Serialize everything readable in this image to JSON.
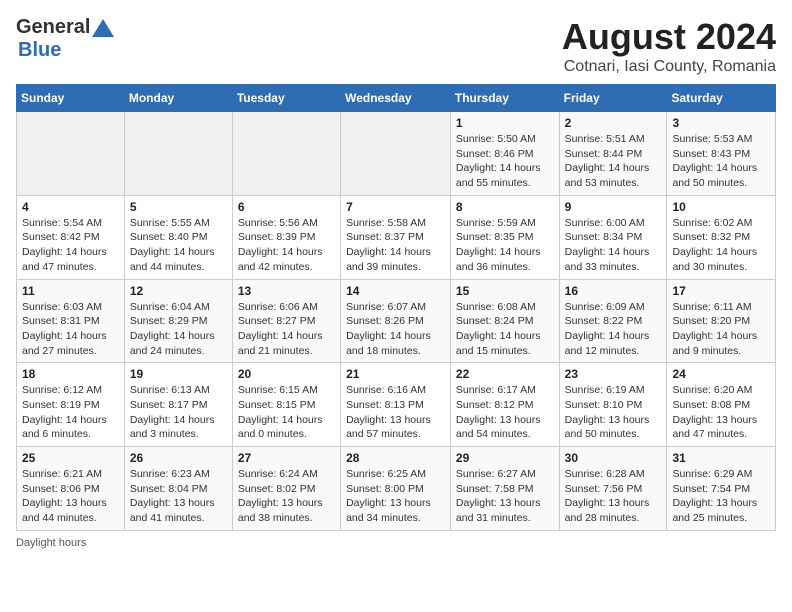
{
  "header": {
    "logo_line1": "General",
    "logo_line2": "Blue",
    "title": "August 2024",
    "subtitle": "Cotnari, Iasi County, Romania"
  },
  "days_of_week": [
    "Sunday",
    "Monday",
    "Tuesday",
    "Wednesday",
    "Thursday",
    "Friday",
    "Saturday"
  ],
  "weeks": [
    [
      {
        "day": "",
        "info": ""
      },
      {
        "day": "",
        "info": ""
      },
      {
        "day": "",
        "info": ""
      },
      {
        "day": "",
        "info": ""
      },
      {
        "day": "1",
        "info": "Sunrise: 5:50 AM\nSunset: 8:46 PM\nDaylight: 14 hours and 55 minutes."
      },
      {
        "day": "2",
        "info": "Sunrise: 5:51 AM\nSunset: 8:44 PM\nDaylight: 14 hours and 53 minutes."
      },
      {
        "day": "3",
        "info": "Sunrise: 5:53 AM\nSunset: 8:43 PM\nDaylight: 14 hours and 50 minutes."
      }
    ],
    [
      {
        "day": "4",
        "info": "Sunrise: 5:54 AM\nSunset: 8:42 PM\nDaylight: 14 hours and 47 minutes."
      },
      {
        "day": "5",
        "info": "Sunrise: 5:55 AM\nSunset: 8:40 PM\nDaylight: 14 hours and 44 minutes."
      },
      {
        "day": "6",
        "info": "Sunrise: 5:56 AM\nSunset: 8:39 PM\nDaylight: 14 hours and 42 minutes."
      },
      {
        "day": "7",
        "info": "Sunrise: 5:58 AM\nSunset: 8:37 PM\nDaylight: 14 hours and 39 minutes."
      },
      {
        "day": "8",
        "info": "Sunrise: 5:59 AM\nSunset: 8:35 PM\nDaylight: 14 hours and 36 minutes."
      },
      {
        "day": "9",
        "info": "Sunrise: 6:00 AM\nSunset: 8:34 PM\nDaylight: 14 hours and 33 minutes."
      },
      {
        "day": "10",
        "info": "Sunrise: 6:02 AM\nSunset: 8:32 PM\nDaylight: 14 hours and 30 minutes."
      }
    ],
    [
      {
        "day": "11",
        "info": "Sunrise: 6:03 AM\nSunset: 8:31 PM\nDaylight: 14 hours and 27 minutes."
      },
      {
        "day": "12",
        "info": "Sunrise: 6:04 AM\nSunset: 8:29 PM\nDaylight: 14 hours and 24 minutes."
      },
      {
        "day": "13",
        "info": "Sunrise: 6:06 AM\nSunset: 8:27 PM\nDaylight: 14 hours and 21 minutes."
      },
      {
        "day": "14",
        "info": "Sunrise: 6:07 AM\nSunset: 8:26 PM\nDaylight: 14 hours and 18 minutes."
      },
      {
        "day": "15",
        "info": "Sunrise: 6:08 AM\nSunset: 8:24 PM\nDaylight: 14 hours and 15 minutes."
      },
      {
        "day": "16",
        "info": "Sunrise: 6:09 AM\nSunset: 8:22 PM\nDaylight: 14 hours and 12 minutes."
      },
      {
        "day": "17",
        "info": "Sunrise: 6:11 AM\nSunset: 8:20 PM\nDaylight: 14 hours and 9 minutes."
      }
    ],
    [
      {
        "day": "18",
        "info": "Sunrise: 6:12 AM\nSunset: 8:19 PM\nDaylight: 14 hours and 6 minutes."
      },
      {
        "day": "19",
        "info": "Sunrise: 6:13 AM\nSunset: 8:17 PM\nDaylight: 14 hours and 3 minutes."
      },
      {
        "day": "20",
        "info": "Sunrise: 6:15 AM\nSunset: 8:15 PM\nDaylight: 14 hours and 0 minutes."
      },
      {
        "day": "21",
        "info": "Sunrise: 6:16 AM\nSunset: 8:13 PM\nDaylight: 13 hours and 57 minutes."
      },
      {
        "day": "22",
        "info": "Sunrise: 6:17 AM\nSunset: 8:12 PM\nDaylight: 13 hours and 54 minutes."
      },
      {
        "day": "23",
        "info": "Sunrise: 6:19 AM\nSunset: 8:10 PM\nDaylight: 13 hours and 50 minutes."
      },
      {
        "day": "24",
        "info": "Sunrise: 6:20 AM\nSunset: 8:08 PM\nDaylight: 13 hours and 47 minutes."
      }
    ],
    [
      {
        "day": "25",
        "info": "Sunrise: 6:21 AM\nSunset: 8:06 PM\nDaylight: 13 hours and 44 minutes."
      },
      {
        "day": "26",
        "info": "Sunrise: 6:23 AM\nSunset: 8:04 PM\nDaylight: 13 hours and 41 minutes."
      },
      {
        "day": "27",
        "info": "Sunrise: 6:24 AM\nSunset: 8:02 PM\nDaylight: 13 hours and 38 minutes."
      },
      {
        "day": "28",
        "info": "Sunrise: 6:25 AM\nSunset: 8:00 PM\nDaylight: 13 hours and 34 minutes."
      },
      {
        "day": "29",
        "info": "Sunrise: 6:27 AM\nSunset: 7:58 PM\nDaylight: 13 hours and 31 minutes."
      },
      {
        "day": "30",
        "info": "Sunrise: 6:28 AM\nSunset: 7:56 PM\nDaylight: 13 hours and 28 minutes."
      },
      {
        "day": "31",
        "info": "Sunrise: 6:29 AM\nSunset: 7:54 PM\nDaylight: 13 hours and 25 minutes."
      }
    ]
  ],
  "footer": "Daylight hours"
}
